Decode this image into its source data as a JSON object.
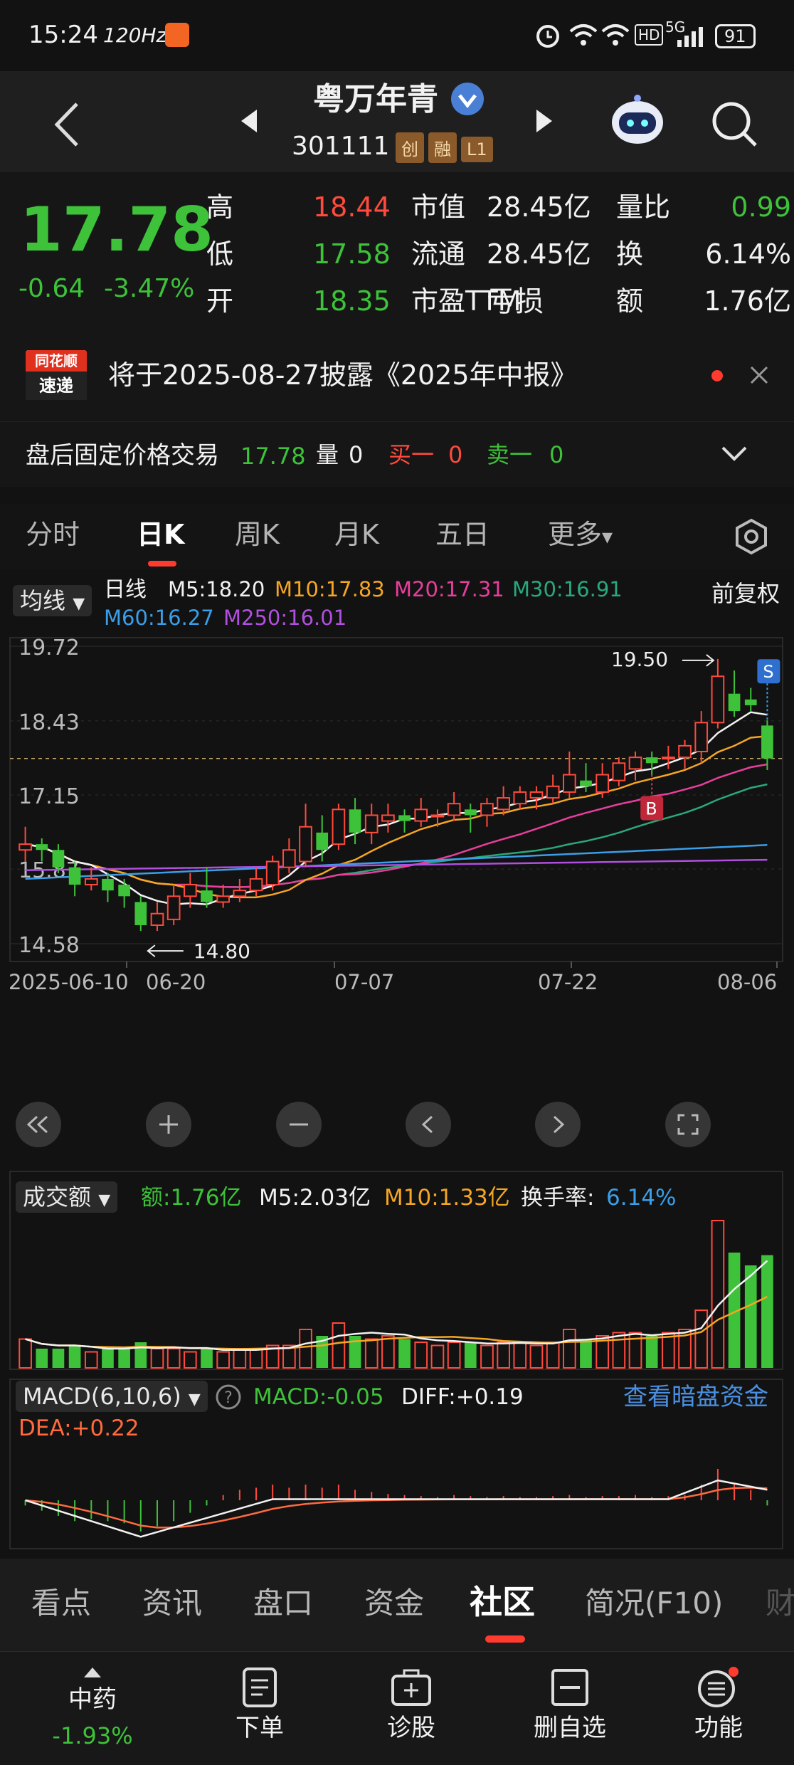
{
  "status_bar": {
    "time": "15:24",
    "refresh": "120Hz",
    "signal": "5G",
    "battery": "91"
  },
  "header": {
    "title": "粤万年青",
    "code": "301111",
    "tags": [
      "创",
      "融",
      "L1"
    ]
  },
  "quote": {
    "price": "17.78",
    "change": "-0.64",
    "change_pct": "-3.47%",
    "rows": [
      {
        "l1": "高",
        "v1": "18.44",
        "l2": "市值",
        "v2": "28.45亿",
        "l3": "量比",
        "v3": "0.99"
      },
      {
        "l1": "低",
        "v1": "17.58",
        "l2": "流通",
        "v2": "28.45亿",
        "l3": "换",
        "v3": "6.14%"
      },
      {
        "l1": "开",
        "v1": "18.35",
        "l2": "市盈TTM",
        "v2": "亏损",
        "l3": "额",
        "v3": "1.76亿"
      }
    ]
  },
  "notice": {
    "logo_top": "同花顺",
    "logo_bottom": "速递",
    "text": "将于2025-08-27披露《2025年中报》"
  },
  "after_hours": {
    "label": "盘后固定价格交易",
    "price": "17.78",
    "vol_label": "量",
    "vol": "0",
    "buy_label": "买一",
    "buy": "0",
    "sell_label": "卖一",
    "sell": "0"
  },
  "period_tabs": [
    {
      "label": "分时",
      "active": false
    },
    {
      "label": "日K",
      "active": true
    },
    {
      "label": "周K",
      "active": false
    },
    {
      "label": "月K",
      "active": false
    },
    {
      "label": "五日",
      "active": false
    },
    {
      "label": "更多",
      "active": false
    }
  ],
  "ma_legend": {
    "selector": "均线",
    "type": "日线",
    "adjust": "前复权",
    "items": [
      {
        "text": "M5:18.20",
        "color": "#f2f2f2"
      },
      {
        "text": "M10:17.83",
        "color": "#f5a623"
      },
      {
        "text": "M20:17.31",
        "color": "#e83e9c"
      },
      {
        "text": "M30:16.91",
        "color": "#2aa87a"
      },
      {
        "text": "M60:16.27",
        "color": "#3a9ee8"
      },
      {
        "text": "M250:16.01",
        "color": "#b04fe0"
      }
    ]
  },
  "chart_data": [
    {
      "type": "candlestick",
      "y_ticks": [
        "19.72",
        "18.43",
        "17.15",
        "15.87",
        "14.58"
      ],
      "ylim": [
        14.58,
        19.72
      ],
      "x_ticks": [
        "2025-06-10",
        "06-20",
        "07-07",
        "07-22",
        "08-06"
      ],
      "max_label": "19.50",
      "min_label": "14.80",
      "markers": [
        "B",
        "S"
      ],
      "candles": [
        {
          "o": 16.2,
          "c": 16.3,
          "h": 16.6,
          "l": 16.0
        },
        {
          "o": 16.3,
          "c": 16.2,
          "h": 16.4,
          "l": 16.0
        },
        {
          "o": 16.2,
          "c": 15.9,
          "h": 16.3,
          "l": 15.8
        },
        {
          "o": 15.9,
          "c": 15.6,
          "h": 16.0,
          "l": 15.4
        },
        {
          "o": 15.6,
          "c": 15.7,
          "h": 15.9,
          "l": 15.5
        },
        {
          "o": 15.7,
          "c": 15.5,
          "h": 15.8,
          "l": 15.3
        },
        {
          "o": 15.6,
          "c": 15.4,
          "h": 15.7,
          "l": 15.2
        },
        {
          "o": 15.3,
          "c": 14.9,
          "h": 15.4,
          "l": 14.8
        },
        {
          "o": 14.9,
          "c": 15.1,
          "h": 15.3,
          "l": 14.8
        },
        {
          "o": 15.0,
          "c": 15.4,
          "h": 15.6,
          "l": 14.9
        },
        {
          "o": 15.4,
          "c": 15.6,
          "h": 15.8,
          "l": 15.2
        },
        {
          "o": 15.5,
          "c": 15.3,
          "h": 15.9,
          "l": 15.2
        },
        {
          "o": 15.3,
          "c": 15.4,
          "h": 15.6,
          "l": 15.2
        },
        {
          "o": 15.4,
          "c": 15.5,
          "h": 15.7,
          "l": 15.3
        },
        {
          "o": 15.5,
          "c": 15.7,
          "h": 15.9,
          "l": 15.4
        },
        {
          "o": 15.6,
          "c": 16.0,
          "h": 16.1,
          "l": 15.5
        },
        {
          "o": 15.9,
          "c": 16.2,
          "h": 16.4,
          "l": 15.8
        },
        {
          "o": 16.0,
          "c": 16.6,
          "h": 17.0,
          "l": 15.9
        },
        {
          "o": 16.5,
          "c": 16.2,
          "h": 16.8,
          "l": 16.0
        },
        {
          "o": 16.3,
          "c": 16.9,
          "h": 17.0,
          "l": 16.2
        },
        {
          "o": 16.9,
          "c": 16.5,
          "h": 17.1,
          "l": 16.3
        },
        {
          "o": 16.5,
          "c": 16.8,
          "h": 17.0,
          "l": 16.3
        },
        {
          "o": 16.7,
          "c": 16.8,
          "h": 17.0,
          "l": 16.5
        },
        {
          "o": 16.8,
          "c": 16.7,
          "h": 16.9,
          "l": 16.5
        },
        {
          "o": 16.7,
          "c": 16.9,
          "h": 17.1,
          "l": 16.6
        },
        {
          "o": 16.8,
          "c": 16.8,
          "h": 16.9,
          "l": 16.6
        },
        {
          "o": 16.8,
          "c": 17.0,
          "h": 17.2,
          "l": 16.7
        },
        {
          "o": 16.9,
          "c": 16.8,
          "h": 17.0,
          "l": 16.5
        },
        {
          "o": 16.8,
          "c": 17.0,
          "h": 17.1,
          "l": 16.6
        },
        {
          "o": 16.9,
          "c": 17.1,
          "h": 17.3,
          "l": 16.8
        },
        {
          "o": 17.0,
          "c": 17.2,
          "h": 17.3,
          "l": 16.9
        },
        {
          "o": 17.1,
          "c": 17.2,
          "h": 17.3,
          "l": 16.9
        },
        {
          "o": 17.1,
          "c": 17.3,
          "h": 17.5,
          "l": 17.0
        },
        {
          "o": 17.2,
          "c": 17.5,
          "h": 17.9,
          "l": 17.1
        },
        {
          "o": 17.4,
          "c": 17.3,
          "h": 17.7,
          "l": 17.2
        },
        {
          "o": 17.2,
          "c": 17.5,
          "h": 17.7,
          "l": 17.1
        },
        {
          "o": 17.4,
          "c": 17.7,
          "h": 17.8,
          "l": 17.3
        },
        {
          "o": 17.6,
          "c": 17.8,
          "h": 17.9,
          "l": 17.4
        },
        {
          "o": 17.8,
          "c": 17.7,
          "h": 17.9,
          "l": 17.5
        },
        {
          "o": 17.8,
          "c": 17.8,
          "h": 18.0,
          "l": 17.6
        },
        {
          "o": 17.8,
          "c": 18.0,
          "h": 18.1,
          "l": 17.6
        },
        {
          "o": 17.9,
          "c": 18.4,
          "h": 18.6,
          "l": 17.7
        },
        {
          "o": 18.4,
          "c": 19.2,
          "h": 19.5,
          "l": 18.3
        },
        {
          "o": 18.9,
          "c": 18.6,
          "h": 19.3,
          "l": 18.5
        },
        {
          "o": 18.8,
          "c": 18.7,
          "h": 19.0,
          "l": 18.6
        },
        {
          "o": 18.35,
          "c": 17.78,
          "h": 18.44,
          "l": 17.58
        }
      ],
      "price_line": 17.78
    },
    {
      "type": "bar",
      "title": "成交额",
      "legend": [
        {
          "text": "额:1.76亿",
          "color": "#3ec23a"
        },
        {
          "text": "M5:2.03亿",
          "color": "#f2f2f2"
        },
        {
          "text": "M10:1.33亿",
          "color": "#f5a623"
        },
        {
          "text": "换手率:",
          "color": "#f2f2f2"
        },
        {
          "text": "6.14%",
          "color": "#3a9ee8"
        }
      ],
      "values": [
        0.45,
        0.3,
        0.3,
        0.35,
        0.25,
        0.3,
        0.3,
        0.4,
        0.3,
        0.3,
        0.25,
        0.3,
        0.25,
        0.3,
        0.3,
        0.35,
        0.35,
        0.6,
        0.5,
        0.7,
        0.5,
        0.45,
        0.5,
        0.45,
        0.4,
        0.35,
        0.4,
        0.4,
        0.35,
        0.4,
        0.4,
        0.35,
        0.4,
        0.6,
        0.45,
        0.5,
        0.55,
        0.55,
        0.5,
        0.55,
        0.6,
        0.9,
        2.3,
        1.8,
        1.6,
        1.76
      ],
      "ylim": [
        0,
        2.4
      ]
    },
    {
      "type": "macd",
      "title": "MACD(6,10,6)",
      "legend": [
        {
          "text": "MACD:-0.05",
          "color": "#3ec23a"
        },
        {
          "text": "DIFF:+0.19",
          "color": "#f2f2f2"
        },
        {
          "text": "DEA:+0.22",
          "color": "#ff6a3d"
        }
      ],
      "link": "查看暗盘资金",
      "hist": [
        -0.05,
        -0.1,
        -0.15,
        -0.2,
        -0.18,
        -0.2,
        -0.22,
        -0.3,
        -0.25,
        -0.2,
        -0.12,
        -0.05,
        0.05,
        0.1,
        0.12,
        0.15,
        0.12,
        0.15,
        0.12,
        0.15,
        0.1,
        0.08,
        0.06,
        0.05,
        0.04,
        0.03,
        0.05,
        0.04,
        0.03,
        0.04,
        0.03,
        0.03,
        0.04,
        0.05,
        0.03,
        0.04,
        0.04,
        0.05,
        0.03,
        0.04,
        0.05,
        0.15,
        0.3,
        0.15,
        0.1,
        -0.05
      ],
      "ylim": [
        -0.45,
        0.45
      ]
    }
  ],
  "chart_nav": [
    "fast-back",
    "zoom-in",
    "zoom-out",
    "prev",
    "next",
    "fullscreen"
  ],
  "bottom_tabs": [
    {
      "label": "看点",
      "active": false
    },
    {
      "label": "资讯",
      "active": false
    },
    {
      "label": "盘口",
      "active": false
    },
    {
      "label": "资金",
      "active": false
    },
    {
      "label": "社区",
      "active": true
    },
    {
      "label": "简况(F10)",
      "active": false
    },
    {
      "label": "财",
      "active": false
    }
  ],
  "toolbar": {
    "sector": "中药",
    "sector_change": "-1.93%",
    "items": [
      "下单",
      "诊股",
      "删自选",
      "功能"
    ]
  }
}
